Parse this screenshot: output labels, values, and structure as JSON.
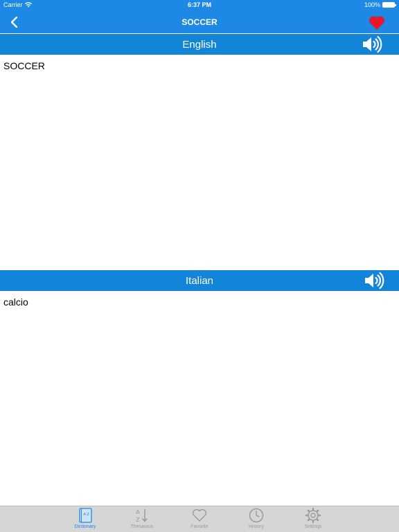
{
  "status_bar": {
    "carrier": "Carrier",
    "time": "6:37 PM",
    "battery": "100%"
  },
  "nav": {
    "title": "SOCCER",
    "back_icon": "chevron-left-icon",
    "favorite_icon": "heart-icon"
  },
  "source": {
    "language": "English",
    "text": "SOCCER"
  },
  "target": {
    "language": "Italian",
    "text": "calcio"
  },
  "tabs": [
    {
      "label": "Dictionary",
      "icon": "dictionary-icon",
      "active": true
    },
    {
      "label": "Thesaurus",
      "icon": "sort-az-icon",
      "active": false
    },
    {
      "label": "Favorite",
      "icon": "heart-outline-icon",
      "active": false
    },
    {
      "label": "History",
      "icon": "clock-icon",
      "active": false
    },
    {
      "label": "Settings",
      "icon": "gear-icon",
      "active": false
    }
  ],
  "colors": {
    "bar_blue": "#1e88e5",
    "section_blue": "#1385d8",
    "favorite_red": "#e8162a",
    "tab_active": "#1e88e5",
    "tab_inactive": "#9a9a9a"
  }
}
